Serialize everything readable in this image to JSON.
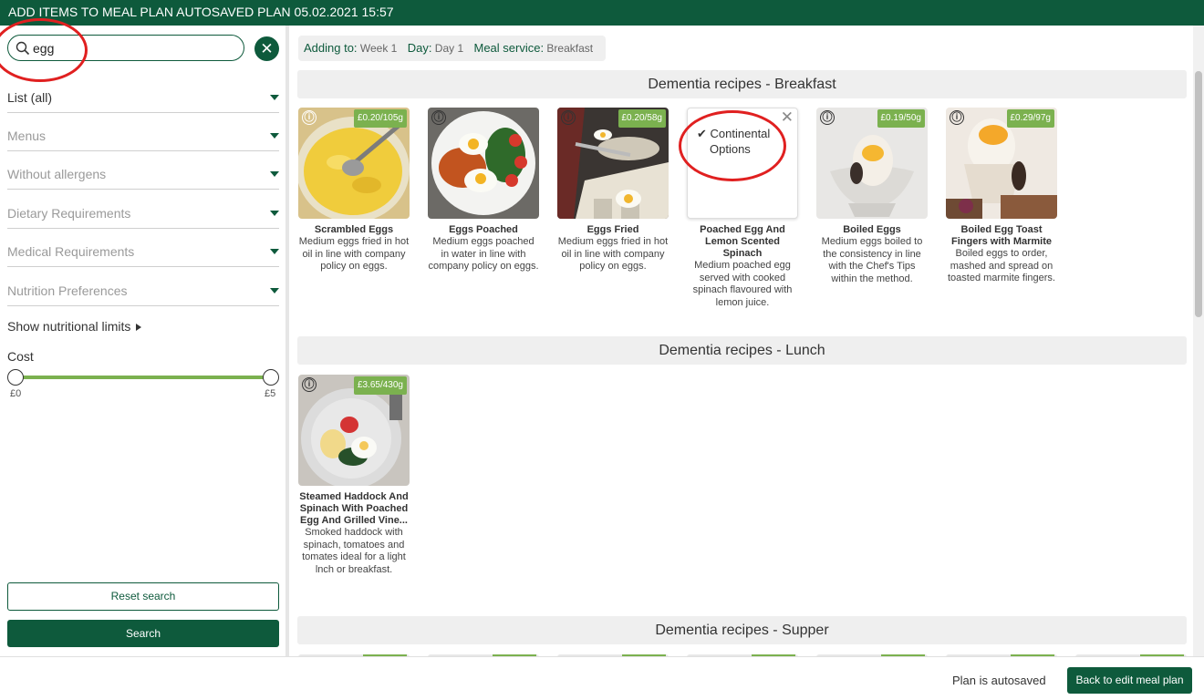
{
  "topbar": {
    "title": "ADD ITEMS TO MEAL PLAN AUTOSAVED PLAN 05.02.2021 15:57"
  },
  "sidebar": {
    "search": {
      "value": "egg",
      "placeholder": ""
    },
    "filters": [
      {
        "label": "List (all)"
      },
      {
        "label": "Menus"
      },
      {
        "label": "Without allergens"
      },
      {
        "label": "Dietary Requirements"
      },
      {
        "label": "Medical Requirements"
      },
      {
        "label": "Nutrition Preferences"
      }
    ],
    "nutritional_limits_label": "Show nutritional limits",
    "cost": {
      "label": "Cost",
      "min_label": "£0",
      "max_label": "£5",
      "range_low": 0,
      "range_high": 5
    },
    "reset_label": "Reset search",
    "search_label": "Search"
  },
  "context": {
    "adding_to_label": "Adding to:",
    "adding_to_value": "Week 1",
    "day_label": "Day:",
    "day_value": "Day 1",
    "service_label": "Meal service:",
    "service_value": "Breakfast"
  },
  "sections": [
    {
      "title": "Dementia recipes - Breakfast",
      "recipes": [
        {
          "name": "Scrambled Eggs",
          "price": "£0.20/105g",
          "description": "Medium eggs fried in hot oil in line with company policy on eggs."
        },
        {
          "name": "Eggs Poached",
          "price": "",
          "description": "Medium eggs poached in water in line with company policy on eggs."
        },
        {
          "name": "Eggs Fried",
          "price": "£0.20/58g",
          "description": "Medium eggs fried in hot oil in line with company policy on eggs."
        },
        {
          "name": "Poached Egg And Lemon Scented Spinach",
          "price": "",
          "description": "Medium poached egg served with cooked spinach flavoured with lemon juice.",
          "option_check": "✔",
          "option_line1": "Continental",
          "option_line2": "Options",
          "close": "✕"
        },
        {
          "name": "Boiled Eggs",
          "price": "£0.19/50g",
          "description": "Medium eggs boiled to the consistency in line with the Chef's Tips within the method."
        },
        {
          "name": "Boiled Egg Toast Fingers with Marmite",
          "price": "£0.29/97g",
          "description": "Boiled eggs to order, mashed and spread on toasted marmite fingers."
        }
      ]
    },
    {
      "title": "Dementia recipes - Lunch",
      "recipes": [
        {
          "name": "Steamed Haddock And Spinach With Poached Egg And Grilled Vine...",
          "price": "£3.65/430g",
          "description": "Smoked haddock with spinach, tomatoes and tomates ideal for a light lnch or breakfast."
        }
      ]
    },
    {
      "title": "Dementia recipes - Supper",
      "recipes": []
    }
  ],
  "icons": {
    "info": "ⓘ",
    "clear": "✕"
  },
  "footer": {
    "autosave_text": "Plan is autosaved",
    "back_label": "Back to edit meal plan"
  },
  "colors": {
    "brand": "#0e5a3c",
    "price_badge": "#7bb14f",
    "annotation": "#e02020"
  }
}
